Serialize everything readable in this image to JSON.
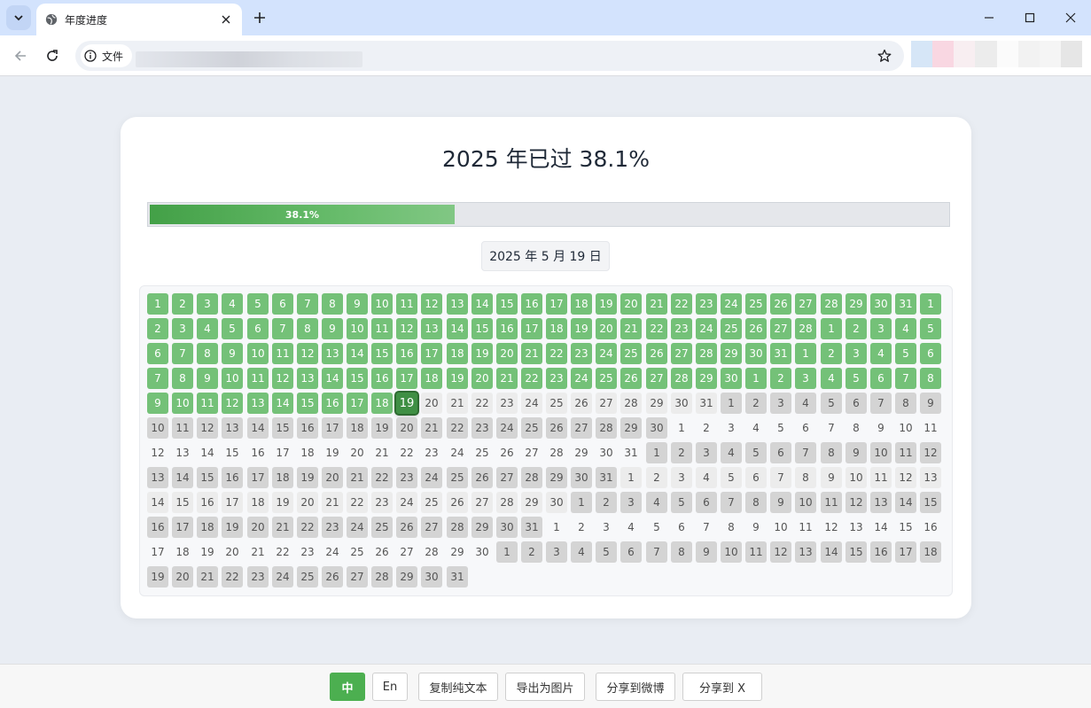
{
  "browser": {
    "tab_title": "年度进度",
    "site_label": "文件"
  },
  "page": {
    "title": "2025 年已过 38.1%",
    "progress_percent": 38.1,
    "progress_label": "38.1%",
    "date_label": "2025 年 5 月 19 日"
  },
  "calendar": {
    "year": 2025,
    "months_days": [
      31,
      28,
      31,
      30,
      31,
      30,
      31,
      31,
      30,
      31,
      30,
      31
    ],
    "today_index": 138,
    "columns": 32
  },
  "bottom": {
    "lang_zh": "中",
    "lang_en": "En",
    "copy_text": "复制纯文本",
    "export_image": "导出为图片",
    "share_weibo": "分享到微博",
    "share_x": "分享到 X"
  },
  "colors": {
    "accent": "#4caf50",
    "past_day": "#74c178",
    "today": "#3f8f44",
    "future_odd_month": "#d4d4d4",
    "future_even_month": "#ececec"
  }
}
